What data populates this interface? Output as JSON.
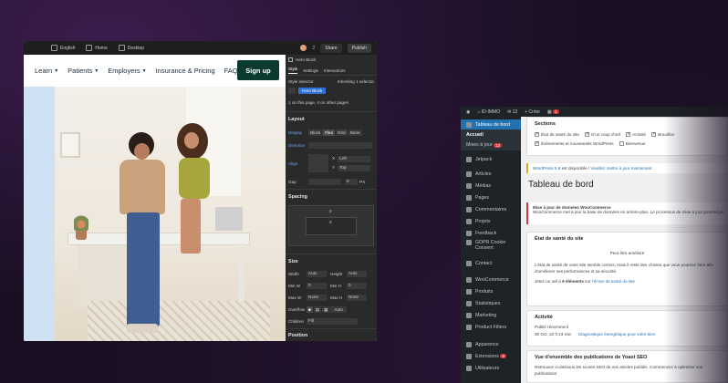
{
  "editor": {
    "topbar": {
      "language": "English",
      "page": "Home",
      "breakpoint": "Desktop",
      "count": "2",
      "share_label": "Share",
      "publish_label": "Publish"
    },
    "site": {
      "nav": [
        "Learn",
        "Patients",
        "Employers",
        "Insurance & Pricing",
        "FAQs"
      ],
      "nav_has_caret": [
        true,
        true,
        true,
        false,
        false
      ],
      "cta_label": "Sign up"
    },
    "panel": {
      "element_name": "Hero Block",
      "tabs": [
        "Style",
        "Settings",
        "Interactions"
      ],
      "style_selector_label": "Style selector",
      "inheriting_label": "Inheriting 1 selector",
      "selector_chip": "Hero Block",
      "usage_note": "1 on this page, 4 on other pages",
      "layout": {
        "heading": "Layout",
        "display_label": "Display",
        "display_options": [
          "Block",
          "Flex",
          "Grid",
          "None"
        ],
        "display_active": "Flex",
        "direction_label": "Direction",
        "align_label": "Align",
        "x_label": "X",
        "x_value": "Left",
        "y_label": "Y",
        "y_value": "Top",
        "gap_label": "Gap",
        "gap_value": "0",
        "gap_unit": "PX"
      },
      "spacing": {
        "heading": "Spacing",
        "margin_value": "0",
        "padding_value": "0"
      },
      "size": {
        "heading": "Size",
        "width_label": "Width",
        "width_value": "Auto",
        "height_label": "Height",
        "height_value": "Auto",
        "min_w_label": "Min W",
        "min_w_value": "0",
        "min_h_label": "Min H",
        "min_h_value": "0",
        "max_w_label": "Max W",
        "max_w_value": "None",
        "max_h_label": "Max H",
        "max_h_value": "None",
        "overflow_label": "Overflow",
        "overflow_value": "Auto",
        "children_label": "Children",
        "children_value": "Fill"
      },
      "position": {
        "heading": "Position"
      }
    }
  },
  "wordpress": {
    "adminbar": {
      "site_name": "ID-IMMO",
      "comments": "12",
      "new_label": "+ Créer",
      "notif_count": "1"
    },
    "sidebar": {
      "items": [
        {
          "label": "Tableau de bord",
          "active": true
        },
        {
          "label": "Accueil",
          "sub": true
        },
        {
          "label": "Mises à jour",
          "sub": true,
          "badge": "12"
        },
        {
          "label": "Jetpack"
        },
        {
          "label": "Articles"
        },
        {
          "label": "Médias"
        },
        {
          "label": "Pages"
        },
        {
          "label": "Commentaires"
        },
        {
          "label": "Projets"
        },
        {
          "label": "Feedback"
        },
        {
          "label": "GDPR Cookie Consent"
        },
        {
          "label": "Contact"
        },
        {
          "label": "WooCommerce"
        },
        {
          "label": "Produits"
        },
        {
          "label": "Statistiques"
        },
        {
          "label": "Marketing"
        },
        {
          "label": "Product Filters"
        },
        {
          "label": "Apparence"
        },
        {
          "label": "Extensions",
          "badge": "8"
        },
        {
          "label": "Utilisateurs"
        }
      ]
    },
    "sections": {
      "heading": "Sections",
      "checkboxes": [
        {
          "label": "État de santé du site",
          "checked": true
        },
        {
          "label": "D'un coup d'œil",
          "checked": true
        },
        {
          "label": "Activité",
          "checked": true
        },
        {
          "label": "Brouillon",
          "checked": true
        },
        {
          "label": "Évènements et nouveautés WordPress",
          "checked": true
        },
        {
          "label": "Bienvenue",
          "checked": false
        }
      ]
    },
    "update_notice": {
      "version_link": "WordPress 5.8",
      "text": "est disponible !",
      "action_link": "Veuillez mettre à jour maintenant"
    },
    "page_title": "Tableau de bord",
    "woo_notice": {
      "title": "Mise à jour de données WooCommerce",
      "text": "WooCommerce met à jour la base de données en arrière-plan. Le processus de mise à jour pourrait prendre un peu de temps."
    },
    "health": {
      "heading": "État de santé du site",
      "status": "Peut être amélioré",
      "text": "L'état de santé de votre site semble correct, mais il reste des choses que vous pourriez faire afin d'améliorer ses performances et sa sécurité.",
      "link_prefix": "Jetez un œil à",
      "link_count": "9 éléments",
      "link_mid": "sur",
      "link_text": "l'écran de santé du site"
    },
    "activity": {
      "heading": "Activité",
      "sub": "Publié récemment",
      "date": "30 Oct, 22 h 23 min",
      "post_title": "Diagnostique énergétique pour votre bien"
    },
    "yoast": {
      "heading": "Vue d'ensemble des publications de Yoast SEO",
      "text": "Retrouvez ci-dessous les scores SEO de vos articles publiés. Commencez à optimiser vos publications"
    }
  }
}
